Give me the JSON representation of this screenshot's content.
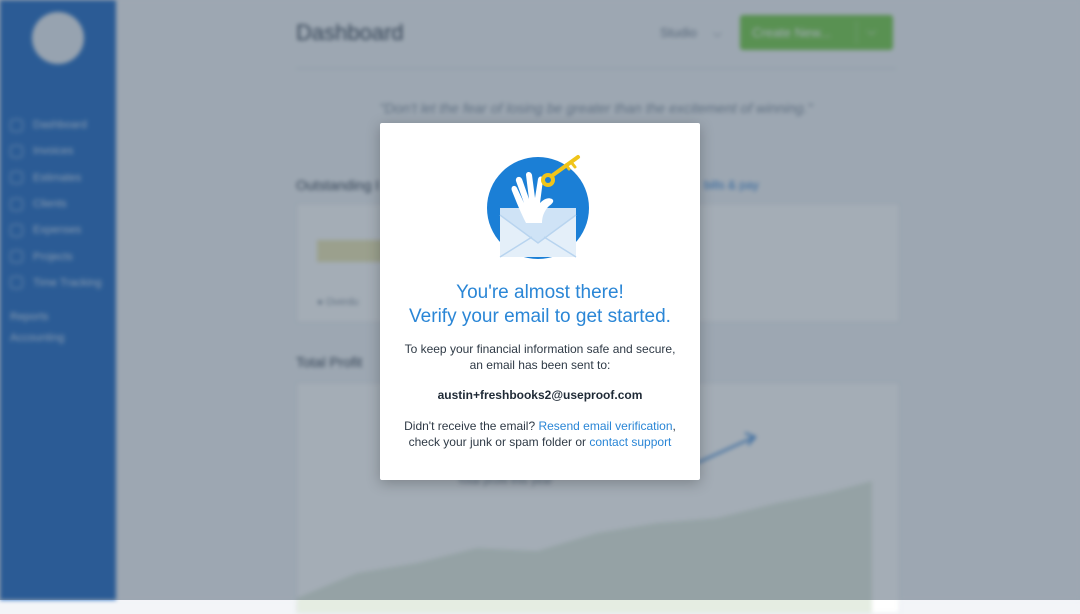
{
  "background": {
    "page_title": "Dashboard",
    "studio_label": "Studio",
    "studio_chevron": "⌵",
    "create_button": "Create New...",
    "create_dropdown": "⌵",
    "quote": "\"Don't let the fear of losing be greater than the excitement of winning.\"",
    "outstanding_title": "Outstanding I",
    "outstanding_link": "bills & pay",
    "outstanding_legend": "● Overdu",
    "total_profit_title": "Total Profit",
    "chart_caption": "Total profit this year",
    "sidebar": {
      "items": [
        {
          "label": "Dashboard",
          "icon": "home-icon"
        },
        {
          "label": "Invoices",
          "icon": "invoice-icon"
        },
        {
          "label": "Estimates",
          "icon": "estimate-icon"
        },
        {
          "label": "Clients",
          "icon": "clients-icon"
        },
        {
          "label": "Expenses",
          "icon": "expenses-icon"
        },
        {
          "label": "Projects",
          "icon": "projects-icon"
        },
        {
          "label": "Time Tracking",
          "icon": "clock-icon"
        }
      ],
      "secondary": [
        "Reports",
        "Accounting"
      ]
    },
    "colors": {
      "sidebar": "#2f73c7",
      "create_button": "#7fcf54"
    }
  },
  "modal": {
    "headline_line1": "You're almost there!",
    "headline_line2": "Verify your email to get started.",
    "body": "To keep your financial information safe and secure, an email has been sent to:",
    "email": "austin+freshbooks2@useproof.com",
    "resend_prefix": "Didn't receive the email? ",
    "resend_link": "Resend email verification",
    "resend_middle": ", check your junk or spam folder or ",
    "support_link": "contact support",
    "illustration": "hand-key-envelope-icon",
    "colors": {
      "accent": "#2a86d6",
      "key": "#f0c419",
      "envelope": "#d7e8f8"
    }
  }
}
